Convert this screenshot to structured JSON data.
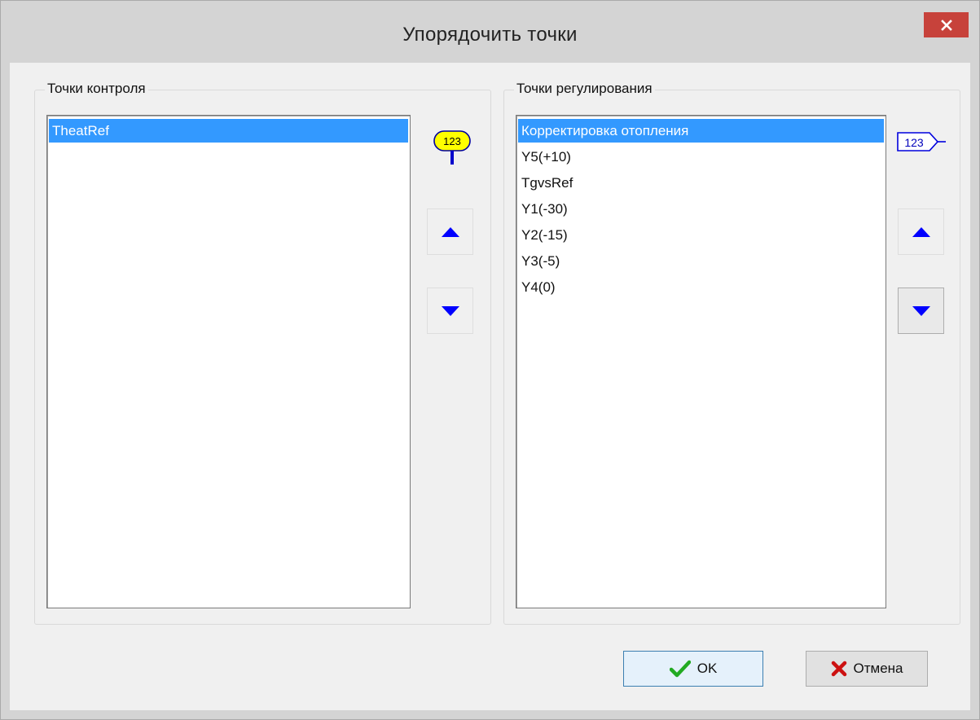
{
  "window": {
    "title": "Упорядочить точки"
  },
  "control_points": {
    "label": "Точки контроля",
    "items": [
      "TheatRef"
    ],
    "selected_index": 0,
    "indicator": {
      "icon": "control-point-marker-icon",
      "text": "123",
      "color": "#ffff00"
    }
  },
  "regulation_points": {
    "label": "Точки регулирования",
    "items": [
      "Корректировка отопления",
      "Y5(+10)",
      "TgvsRef",
      "Y1(-30)",
      "Y2(-15)",
      "Y3(-5)",
      "Y4(0)"
    ],
    "selected_index": 0,
    "indicator": {
      "icon": "regulation-point-tag-icon",
      "text": "123",
      "color": "#0000ff"
    }
  },
  "buttons": {
    "ok_label": "OK",
    "cancel_label": "Отмена",
    "ok_icon": "checkmark-icon",
    "cancel_icon": "cross-icon",
    "move_up_icon": "arrow-up-icon",
    "move_down_icon": "arrow-down-icon"
  },
  "colors": {
    "selection": "#3399ff",
    "arrow": "#0000ff",
    "close_button": "#c7423b",
    "ok_check": "#22aa22",
    "cancel_cross": "#cc1111"
  }
}
